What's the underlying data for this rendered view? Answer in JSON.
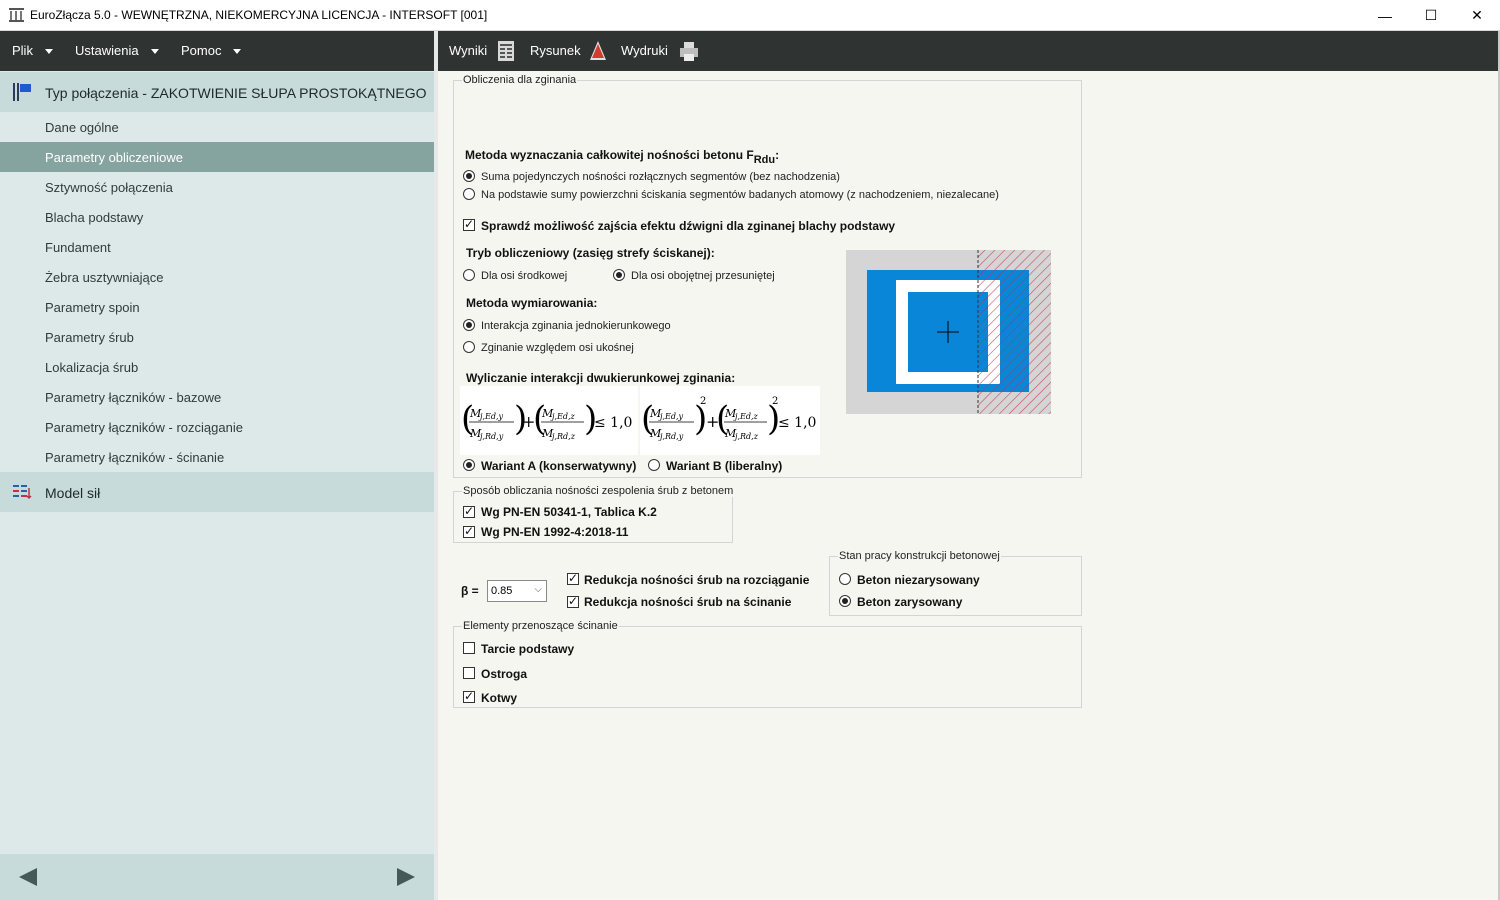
{
  "window": {
    "title": "EuroZłącza 5.0 - WEWNĘTRZNA, NIEKOMERCYJNA LICENCJA - INTERSOFT [001]",
    "minimize": "—",
    "maximize": "☐",
    "close": "✕"
  },
  "menu": {
    "items": [
      "Plik",
      "Ustawienia",
      "Pomoc"
    ]
  },
  "sidebar": {
    "group1": "Typ połączenia - ZAKOTWIENIE SŁUPA PROSTOKĄTNEGO",
    "items": [
      "Dane ogólne",
      "Parametry obliczeniowe",
      "Sztywność połączenia",
      "Blacha podstawy",
      "Fundament",
      "Żebra usztywniające",
      "Parametry spoin",
      "Parametry śrub",
      "Lokalizacja śrub",
      "Parametry łączników - bazowe",
      "Parametry łączników - rozciąganie",
      "Parametry łączników - ścinanie"
    ],
    "active_index": 1,
    "group2": "Model sił"
  },
  "toolbar": {
    "wyniki": "Wyniki",
    "rysunek": "Rysunek",
    "wydruki": "Wydruki"
  },
  "bending": {
    "legend": "Obliczenia dla zginania",
    "method_title": "Metoda wyznaczania całkowitej nośności betonu F",
    "method_sub": "Rdu",
    "method_colon": ":",
    "method_opt1": "Suma pojedynczych nośności rozłącznych segmentów (bez nachodzenia)",
    "method_opt2": "Na podstawie sumy powierzchni ściskania segmentów badanych atomowy (z nachodzeniem, niezalecane)",
    "lever_check": "Sprawdź możliwość zajścia efektu dźwigni dla zginanej blachy podstawy",
    "mode_title": "Tryb obliczeniowy (zasięg strefy ściskanej):",
    "mode_opt1": "Dla osi środkowej",
    "mode_opt2": "Dla osi obojętnej przesuniętej",
    "dim_title": "Metoda wymiarowania:",
    "dim_opt1": "Interakcja zginania jednokierunkowego",
    "dim_opt2": "Zginanie względem osi ukośnej",
    "interaction_title": "Wyliczanie interakcji dwukierunkowej zginania:",
    "variant_a": "Wariant A (konserwatywny)",
    "variant_b": "Wariant B (liberalny)",
    "formula_a": {
      "n1": "M",
      "n1s": "j,Ed,y",
      "d1": "M",
      "d1s": "j,Rd,y",
      "n2": "M",
      "n2s": "j,Ed,z",
      "d2": "M",
      "d2s": "j,Rd,z",
      "rhs": "≤ 1,0"
    },
    "formula_b": {
      "n1": "M",
      "n1s": "j,Ed,y",
      "d1": "M",
      "d1s": "j,Rd,y",
      "n2": "M",
      "n2s": "j,Ed,z",
      "d2": "M",
      "d2s": "j,Rd,z",
      "exp": "2",
      "rhs": "≤ 1,0"
    }
  },
  "bond": {
    "legend": "Sposób obliczania nośności zespolenia śrub z betonem",
    "opt1": "Wg PN-EN 50341-1, Tablica K.2",
    "opt2": "Wg PN-EN 1992-4:2018-11"
  },
  "beta": {
    "label": "β =",
    "value": "0.85",
    "reduce_tension": "Redukcja nośności śrub na rozciąganie",
    "reduce_shear": "Redukcja nośności śrub na ścinanie"
  },
  "concrete": {
    "legend": "Stan pracy konstrukcji betonowej",
    "opt1": "Beton niezarysowany",
    "opt2": "Beton zarysowany"
  },
  "shear": {
    "legend": "Elementy przenoszące ścinanie",
    "opt1": "Tarcie podstawy",
    "opt2": "Ostroga",
    "opt3": "Kotwy"
  },
  "colors": {
    "accent_blue": "#0a86d8",
    "hatch": "#c0304a",
    "dark_bar": "#2f3433",
    "active_item": "#85a39f"
  }
}
